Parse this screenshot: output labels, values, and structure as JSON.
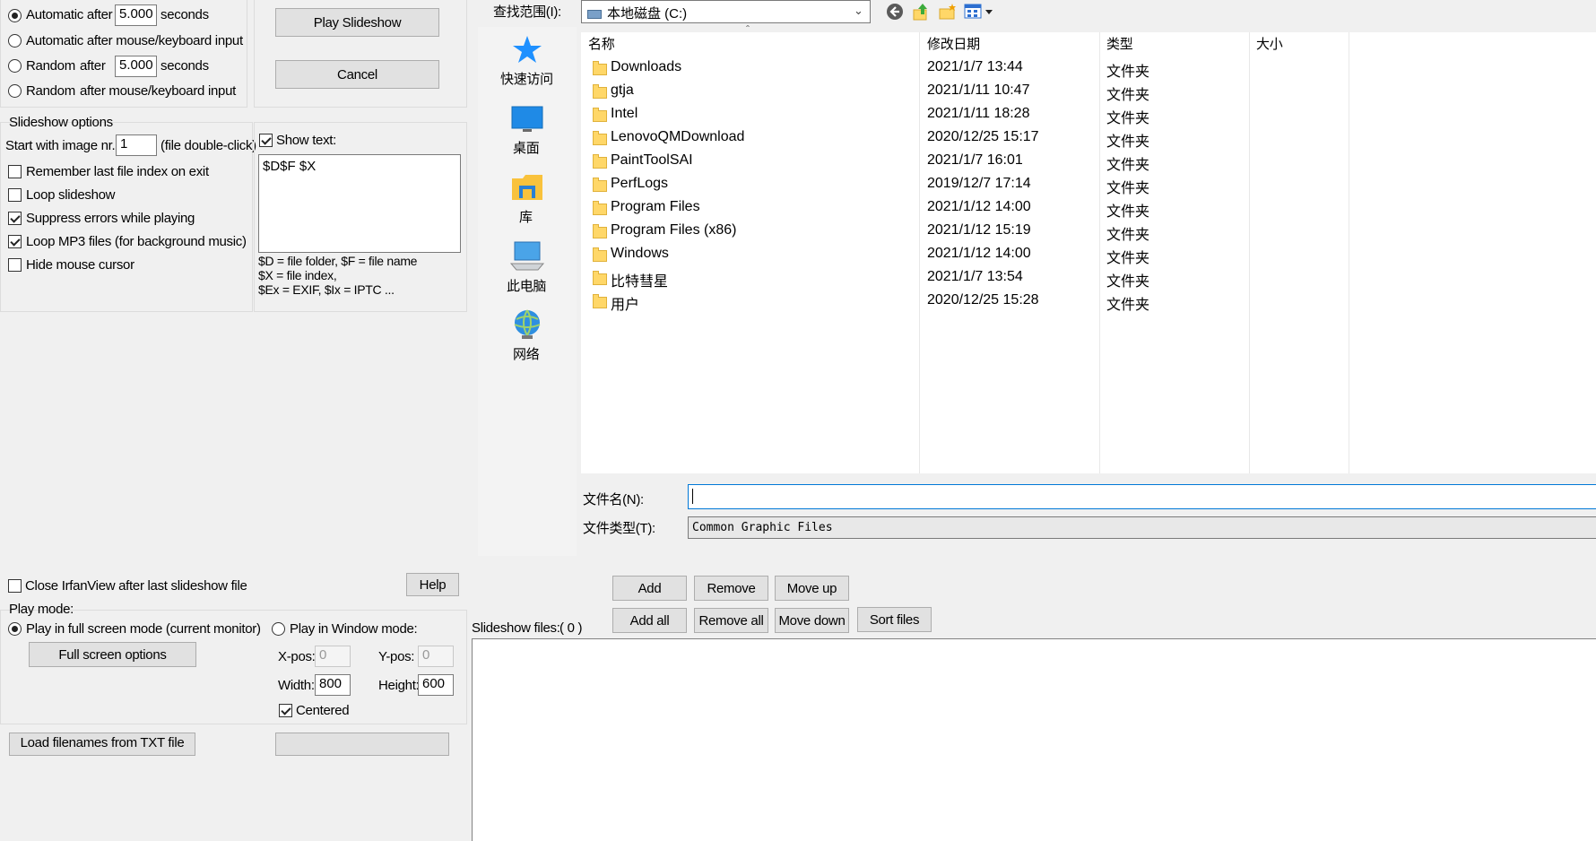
{
  "timing": {
    "auto_label": "Automatic after",
    "auto_value": "5.000",
    "seconds1": "seconds",
    "auto_input_label": "Automatic after mouse/keyboard input",
    "random_label": "Random",
    "random_after": "after",
    "random_value": "5.000",
    "seconds2": "seconds",
    "random_input_label1": "Random",
    "random_input_label2": "after mouse/keyboard input",
    "selected": "auto"
  },
  "buttons": {
    "play": "Play Slideshow",
    "cancel": "Cancel",
    "help": "Help",
    "full_screen_options": "Full screen options",
    "load_txt": "Load filenames from TXT file",
    "add": "Add",
    "remove": "Remove",
    "move_up": "Move up",
    "add_all": "Add all",
    "remove_all": "Remove all",
    "move_down": "Move down",
    "sort_files": "Sort files"
  },
  "slideshow_options": {
    "title": "Slideshow options",
    "start_label": "Start with image nr.:",
    "start_value": "1",
    "start_hint": "(file double-click)",
    "remember": {
      "label": "Remember last file index on exit",
      "checked": false
    },
    "loop": {
      "label": "Loop slideshow",
      "checked": false
    },
    "suppress": {
      "label": "Suppress errors while playing",
      "checked": true
    },
    "loop_mp3": {
      "label": "Loop MP3 files (for background music)",
      "checked": true
    },
    "hide_cursor": {
      "label": "Hide mouse cursor",
      "checked": false
    }
  },
  "show_text": {
    "label": "Show text:",
    "checked": true,
    "value": "$D$F $X",
    "help1": "$D = file folder, $F = file name",
    "help2": "$X = file index,",
    "help3": "$Ex = EXIF, $Ix = IPTC ..."
  },
  "close_after": {
    "label": "Close IrfanView after last slideshow file",
    "checked": false
  },
  "play_mode": {
    "title": "Play mode:",
    "full_label": "Play in full screen mode (current monitor)",
    "window_label": "Play in Window mode:",
    "xpos_label": "X-pos:",
    "xpos": "0",
    "ypos_label": "Y-pos:",
    "ypos": "0",
    "width_label": "Width:",
    "width": "800",
    "height_label": "Height:",
    "height": "600",
    "centered_label": "Centered",
    "centered": true
  },
  "file_dialog": {
    "lookin_label": "查找范围(I):",
    "lookin_value": "本地磁盘 (C:)",
    "places": [
      "快速访问",
      "桌面",
      "库",
      "此电脑",
      "网络"
    ],
    "columns": [
      "名称",
      "修改日期",
      "类型",
      "大小"
    ],
    "files": [
      {
        "name": "Downloads",
        "date": "2021/1/7 13:44",
        "type": "文件夹"
      },
      {
        "name": "gtja",
        "date": "2021/1/11 10:47",
        "type": "文件夹"
      },
      {
        "name": "Intel",
        "date": "2021/1/11 18:28",
        "type": "文件夹"
      },
      {
        "name": "LenovoQMDownload",
        "date": "2020/12/25 15:17",
        "type": "文件夹"
      },
      {
        "name": "PaintToolSAI",
        "date": "2021/1/7 16:01",
        "type": "文件夹"
      },
      {
        "name": "PerfLogs",
        "date": "2019/12/7 17:14",
        "type": "文件夹"
      },
      {
        "name": "Program Files",
        "date": "2021/1/12 14:00",
        "type": "文件夹"
      },
      {
        "name": "Program Files (x86)",
        "date": "2021/1/12 15:19",
        "type": "文件夹"
      },
      {
        "name": "Windows",
        "date": "2021/1/12 14:00",
        "type": "文件夹"
      },
      {
        "name": "比特彗星",
        "date": "2021/1/7 13:54",
        "type": "文件夹"
      },
      {
        "name": "用户",
        "date": "2020/12/25 15:28",
        "type": "文件夹"
      }
    ],
    "filename_label": "文件名(N):",
    "filename_value": "",
    "filetype_label": "文件类型(T):",
    "filetype_value": "Common Graphic Files"
  },
  "slideshow_files": {
    "label": "Slideshow files:",
    "count": "( 0 )"
  },
  "colors": {
    "accent": "#0078d7",
    "folder": "#ffd768",
    "star": "#1e90ff"
  }
}
